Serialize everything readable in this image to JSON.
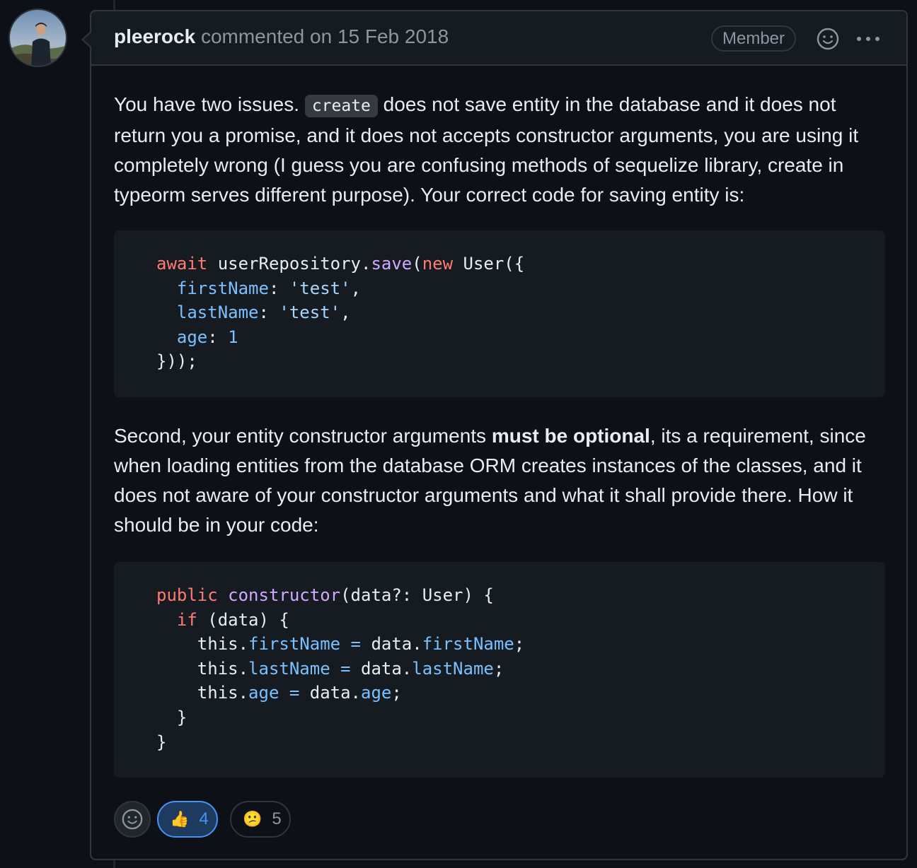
{
  "comment": {
    "author": "pleerock",
    "action_text": "commented on 15 Feb 2018",
    "badge": "Member",
    "para1": {
      "before_code": "You have two issues. ",
      "code": "create",
      "after_code": " does not save entity in the database and it does not return you a promise, and it does not accepts constructor arguments, you are using it completely wrong (I guess you are confusing methods of sequelize library, create in typeorm serves different purpose). Your correct code for saving entity is:"
    },
    "code1": [
      [
        [
          "kw",
          "await"
        ],
        [
          "t",
          " userRepository."
        ],
        [
          "fn",
          "save"
        ],
        [
          "t",
          "("
        ],
        [
          "kw",
          "new"
        ],
        [
          "t",
          " User({"
        ]
      ],
      [
        [
          "t",
          "  "
        ],
        [
          "prop",
          "firstName"
        ],
        [
          "t",
          ": "
        ],
        [
          "str",
          "'test'"
        ],
        [
          "t",
          ","
        ]
      ],
      [
        [
          "t",
          "  "
        ],
        [
          "prop",
          "lastName"
        ],
        [
          "t",
          ": "
        ],
        [
          "str",
          "'test'"
        ],
        [
          "t",
          ","
        ]
      ],
      [
        [
          "t",
          "  "
        ],
        [
          "prop",
          "age"
        ],
        [
          "t",
          ": "
        ],
        [
          "num",
          "1"
        ]
      ],
      [
        [
          "t",
          "}));"
        ]
      ]
    ],
    "para2": {
      "before_bold": "Second, your entity constructor arguments ",
      "bold": "must be optional",
      "after_bold": ", its a requirement, since when loading entities from the database ORM creates instances of the classes, and it does not aware of your constructor arguments and what it shall provide there. How it should be in your code:"
    },
    "code2": [
      [
        [
          "kw",
          "public"
        ],
        [
          "t",
          " "
        ],
        [
          "fn",
          "constructor"
        ],
        [
          "t",
          "(data?: User) {"
        ]
      ],
      [
        [
          "t",
          "  "
        ],
        [
          "kw",
          "if"
        ],
        [
          "t",
          " (data) {"
        ]
      ],
      [
        [
          "t",
          "    this."
        ],
        [
          "prop",
          "firstName"
        ],
        [
          "t",
          " "
        ],
        [
          "prop",
          "="
        ],
        [
          "t",
          " data."
        ],
        [
          "prop",
          "firstName"
        ],
        [
          "t",
          ";"
        ]
      ],
      [
        [
          "t",
          "    this."
        ],
        [
          "prop",
          "lastName"
        ],
        [
          "t",
          " "
        ],
        [
          "prop",
          "="
        ],
        [
          "t",
          " data."
        ],
        [
          "prop",
          "lastName"
        ],
        [
          "t",
          ";"
        ]
      ],
      [
        [
          "t",
          "    this."
        ],
        [
          "prop",
          "age"
        ],
        [
          "t",
          " "
        ],
        [
          "prop",
          "="
        ],
        [
          "t",
          " data."
        ],
        [
          "prop",
          "age"
        ],
        [
          "t",
          ";"
        ]
      ],
      [
        [
          "t",
          "  }"
        ]
      ],
      [
        [
          "t",
          "}"
        ]
      ]
    ],
    "reactions": [
      {
        "emoji": "👍",
        "count": "4"
      },
      {
        "emoji": "😕",
        "count": "5"
      }
    ]
  }
}
